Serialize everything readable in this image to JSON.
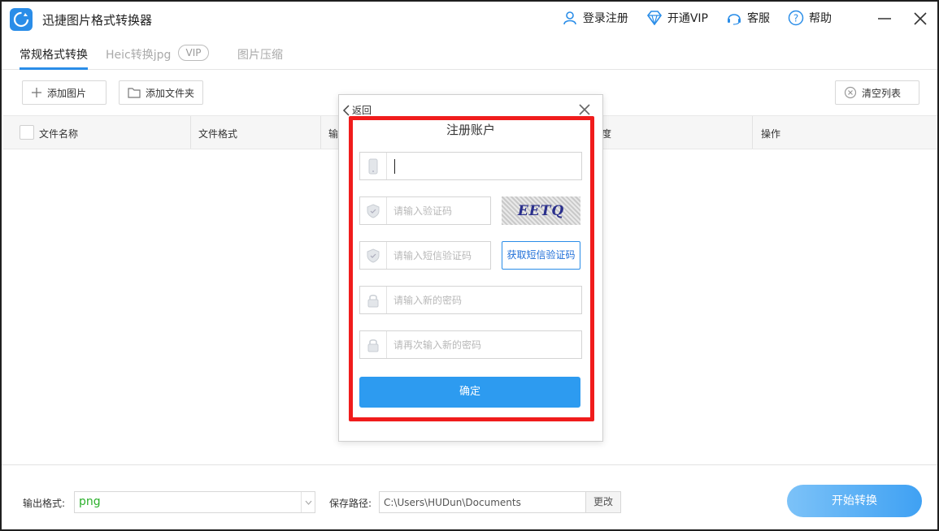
{
  "app": {
    "title": "迅捷图片格式转换器",
    "logo_icon": "refresh-circle-icon",
    "accent": "#2a8de8"
  },
  "top_actions": [
    {
      "label": "登录注册",
      "icon": "user-icon"
    },
    {
      "label": "开通VIP",
      "icon": "diamond-icon"
    },
    {
      "label": "客服",
      "icon": "headset-icon"
    },
    {
      "label": "帮助",
      "icon": "question-icon"
    }
  ],
  "tabs": {
    "items": [
      "常规格式转换",
      "Heic转换jpg",
      "图片压缩"
    ],
    "vip_badge": "VIP",
    "active_index": 0
  },
  "toolbar": {
    "add_image": "添加图片",
    "add_folder": "添加文件夹",
    "clear_list": "清空列表"
  },
  "table": {
    "columns": [
      "文件名称",
      "文件格式",
      "输",
      "度",
      "操作"
    ]
  },
  "footer": {
    "output_format_label": "输出格式:",
    "output_format_value": "png",
    "save_path_label": "保存路径:",
    "save_path_value": "C:\\Users\\HUDun\\Documents",
    "change_label": "更改",
    "start_label": "开始转换"
  },
  "dialog": {
    "back_label": "返回",
    "title": "注册账户",
    "phone_value": "",
    "captcha_placeholder": "请输入验证码",
    "captcha_text": "EETQ",
    "sms_placeholder": "请输入短信验证码",
    "sms_button": "获取短信验证码",
    "password_placeholder": "请输入新的密码",
    "password_confirm_placeholder": "请再次输入新的密码",
    "confirm_label": "确定",
    "highlight_color": "#f01c1c"
  }
}
